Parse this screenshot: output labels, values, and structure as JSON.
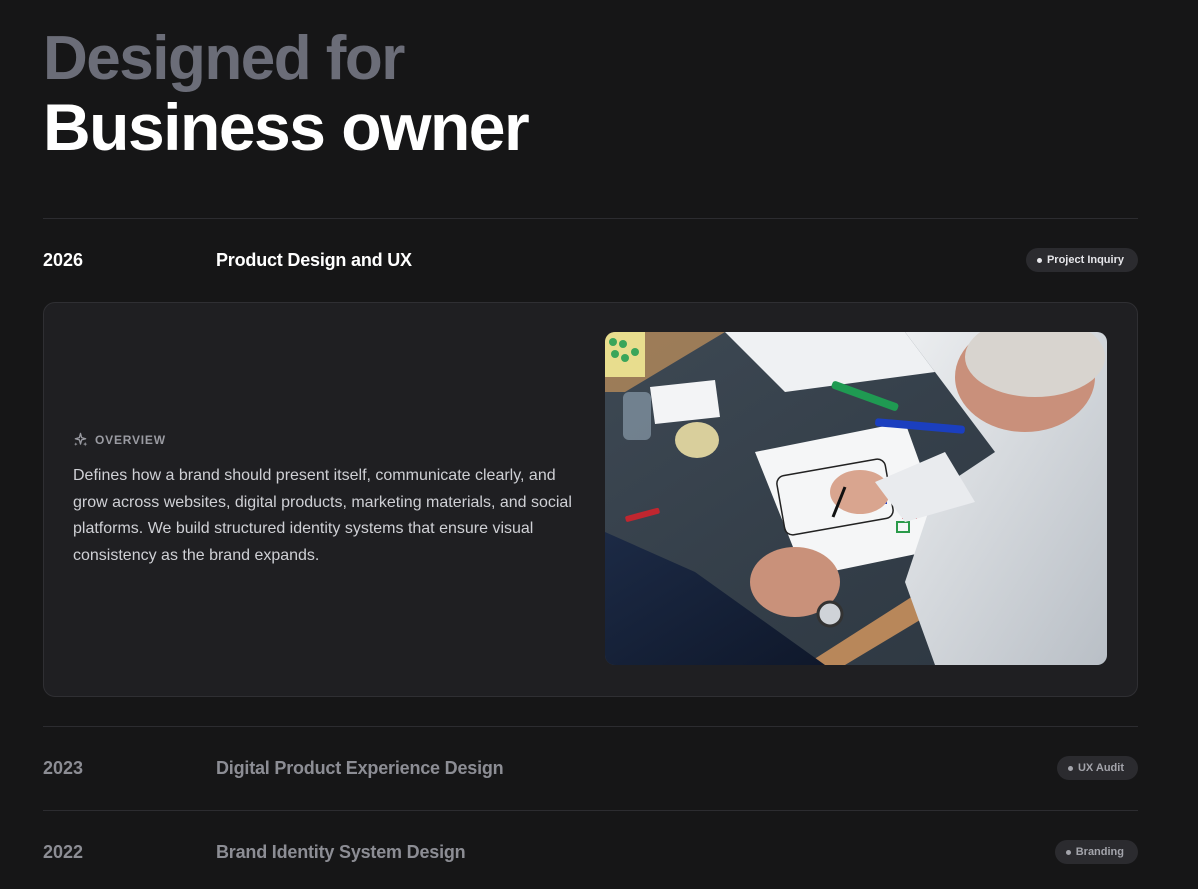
{
  "hero": {
    "line1": "Designed for",
    "line2": "Business owner"
  },
  "projects": [
    {
      "year": "2026",
      "title": "Product Design and UX",
      "badge": "Project Inquiry",
      "expanded": true
    },
    {
      "year": "2023",
      "title": "Digital Product Experience Design",
      "badge": "UX Audit",
      "expanded": false
    },
    {
      "year": "2022",
      "title": "Brand Identity System Design",
      "badge": "Branding",
      "expanded": false
    }
  ],
  "overview": {
    "icon": "sparkles-icon",
    "label": "OVERVIEW",
    "text": "Defines how a brand should present itself, communicate clearly, and grow across websites, digital products, marketing materials, and social platforms. We build structured identity systems that ensure visual consistency as the brand expands."
  },
  "colors": {
    "background": "#161617",
    "card": "#1f1f22",
    "muted_text": "#8c8d94",
    "headline_muted": "#6b6d78"
  }
}
